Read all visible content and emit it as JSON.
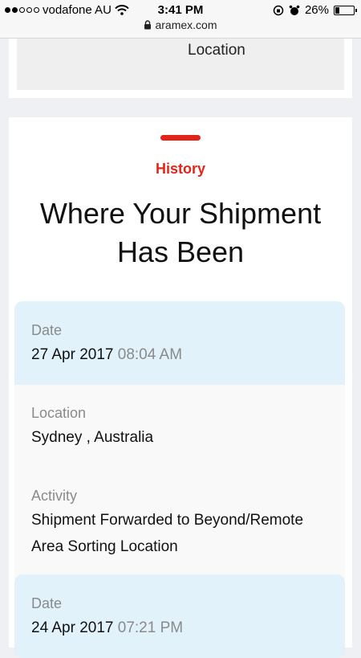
{
  "status_bar": {
    "carrier": "vodafone AU",
    "signal_full": 2,
    "signal_empty": 3,
    "time": "3:41 PM",
    "battery_percent": "26%",
    "battery_level": 0.26,
    "url": "aramex.com"
  },
  "top_card": {
    "label": "Location"
  },
  "history": {
    "kicker": "History",
    "heading": "Where Your Shipment Has Been",
    "entries": [
      {
        "date_label": "Date",
        "date": "27 Apr 2017",
        "time": "08:04 AM",
        "location_label": "Location",
        "location": "Sydney , Australia",
        "activity_label": "Activity",
        "activity": "Shipment Forwarded to Beyond/Remote Area Sorting Location"
      },
      {
        "date_label": "Date",
        "date": "24 Apr 2017",
        "time": "07:21 PM"
      }
    ]
  },
  "colors": {
    "accent": "#e1251b",
    "date_row_bg": "#e1f2fb",
    "page_bg": "#eef0f4"
  }
}
